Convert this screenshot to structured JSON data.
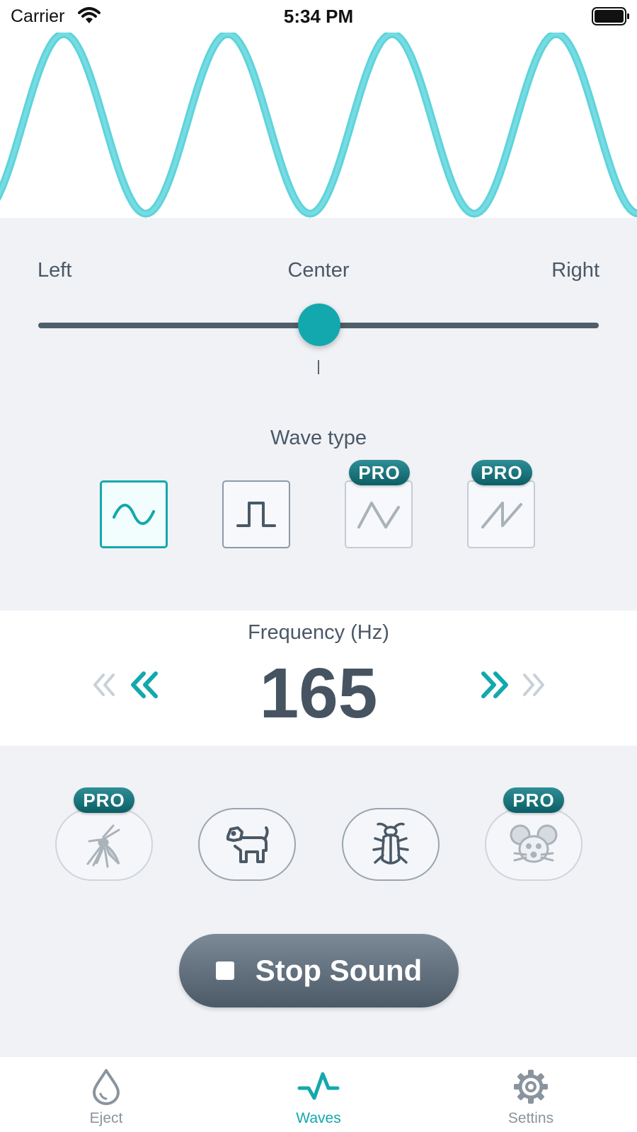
{
  "status_bar": {
    "carrier": "Carrier",
    "time": "5:34 PM"
  },
  "colors": {
    "accent": "#13a8ad",
    "wave": "#5fd3db",
    "dark_text": "#465461",
    "pro_badge": "#1a7a82"
  },
  "balance": {
    "left_label": "Left",
    "center_label": "Center",
    "right_label": "Right",
    "position": 0.5
  },
  "wave_type": {
    "title": "Wave type",
    "options": [
      {
        "name": "sine",
        "icon": "sine-wave-icon",
        "selected": true,
        "pro": false
      },
      {
        "name": "square",
        "icon": "square-wave-icon",
        "selected": false,
        "pro": false
      },
      {
        "name": "triangle",
        "icon": "triangle-wave-icon",
        "selected": false,
        "pro": true,
        "badge": "PRO"
      },
      {
        "name": "sawtooth",
        "icon": "sawtooth-wave-icon",
        "selected": false,
        "pro": true,
        "badge": "PRO"
      }
    ]
  },
  "frequency": {
    "title": "Frequency (Hz)",
    "value": "165"
  },
  "pests": [
    {
      "name": "mosquito",
      "icon": "mosquito-icon",
      "pro": true,
      "badge": "PRO"
    },
    {
      "name": "dog",
      "icon": "dog-icon",
      "pro": false
    },
    {
      "name": "cockroach",
      "icon": "cockroach-icon",
      "pro": false
    },
    {
      "name": "mouse",
      "icon": "mouse-icon",
      "pro": true,
      "badge": "PRO"
    }
  ],
  "stop_button": {
    "label": "Stop Sound"
  },
  "tabs": [
    {
      "label": "Eject",
      "icon": "droplet-icon",
      "active": false
    },
    {
      "label": "Waves",
      "icon": "waveform-icon",
      "active": true
    },
    {
      "label": "Settins",
      "icon": "gear-icon",
      "active": false
    }
  ]
}
